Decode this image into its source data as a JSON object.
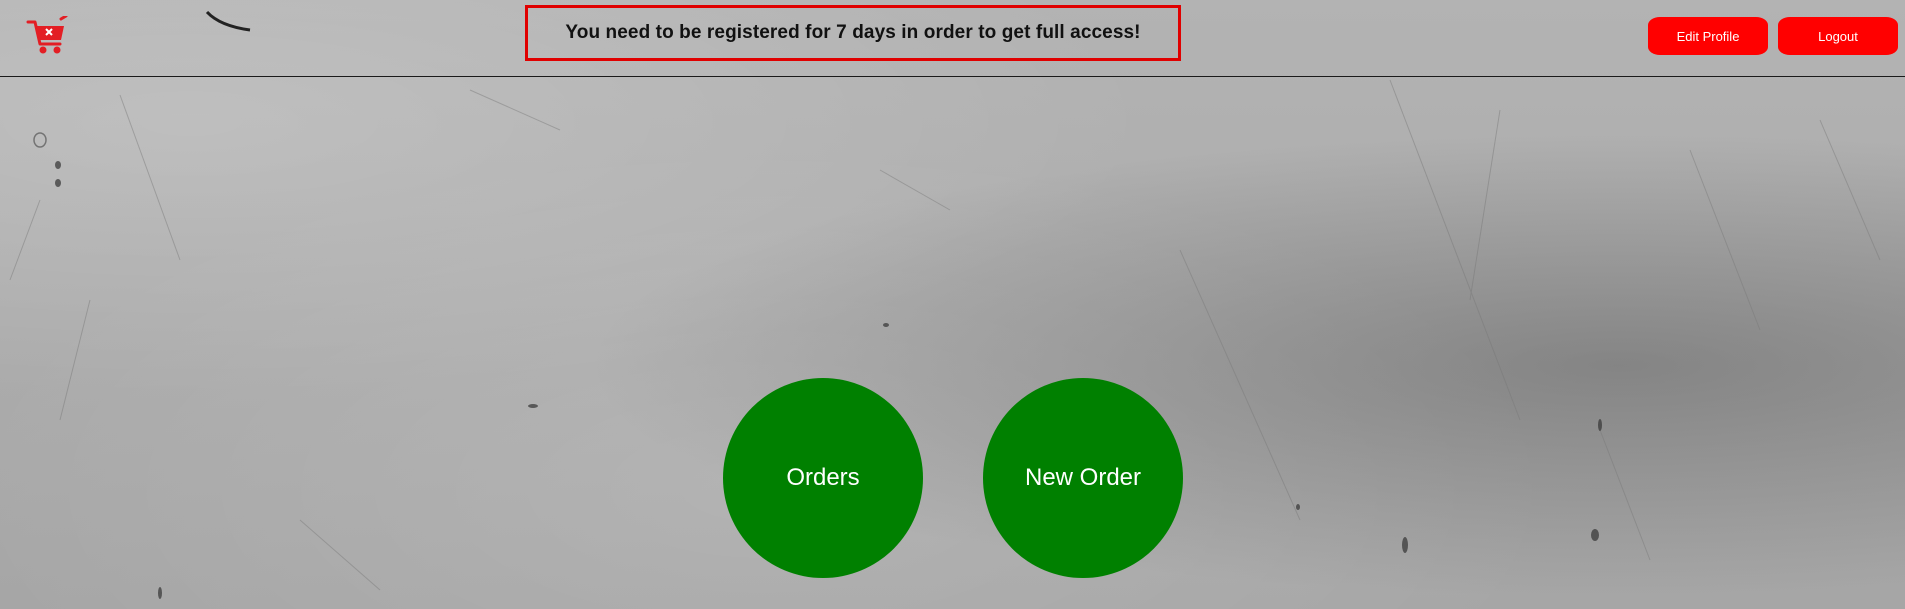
{
  "header": {
    "notice": "You need to be registered for 7 days in order to get full access!",
    "edit_profile_label": "Edit Profile",
    "logout_label": "Logout",
    "logo_icon": "shopping-cart-icon"
  },
  "main": {
    "orders_label": "Orders",
    "new_order_label": "New Order"
  },
  "colors": {
    "accent_red": "#ff0000",
    "action_green": "#008000",
    "background_gray": "#a9a9a9"
  }
}
